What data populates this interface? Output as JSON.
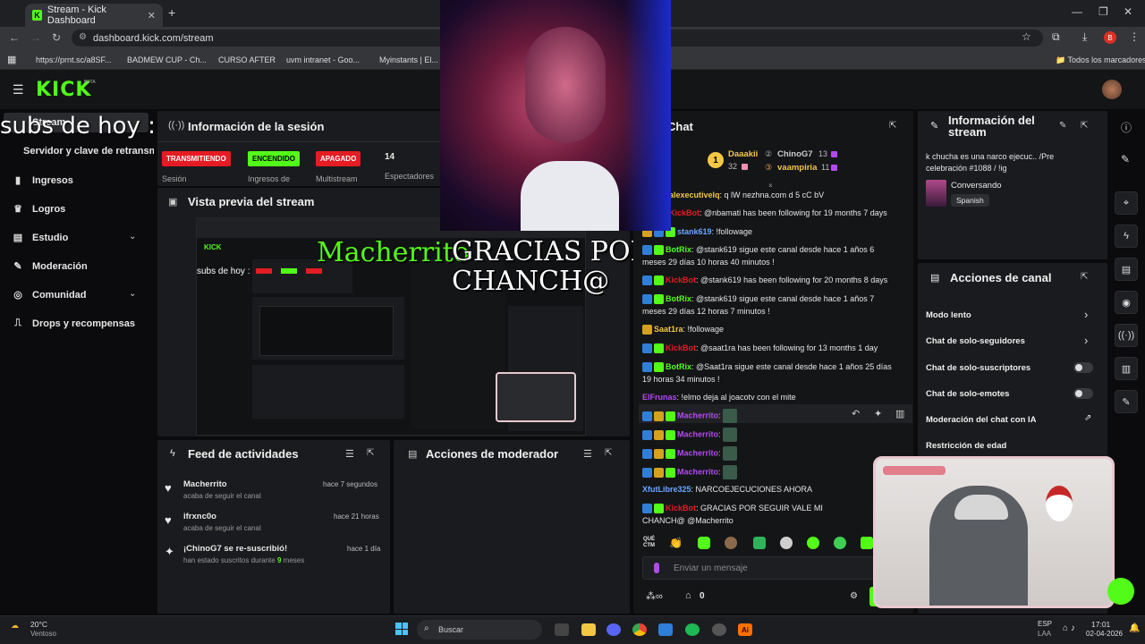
{
  "browser": {
    "tab_title": "Stream - Kick Dashboard",
    "url": "dashboard.kick.com/stream",
    "bookmarks": [
      "https://prnt.sc/a8SF...",
      "BADMEW CUP - Ch...",
      "CURSO AFTER",
      "uvm intranet - Goo...",
      "Myinstants | El..."
    ],
    "all_bookmarks": "Todos los marcadores",
    "profile_initial": "B"
  },
  "kick": {
    "logo": "KICK",
    "beta": "BETA"
  },
  "sidebar": {
    "items": [
      {
        "label": "Stream",
        "icon": "stream-icon"
      },
      {
        "label": "Servidor y clave de retransm",
        "icon": ""
      },
      {
        "label": "Ingresos",
        "icon": "bar-chart-icon"
      },
      {
        "label": "Logros",
        "icon": "trophy-icon"
      },
      {
        "label": "Estudio",
        "icon": "studio-icon"
      },
      {
        "label": "Moderación",
        "icon": "wrench-icon"
      },
      {
        "label": "Comunidad",
        "icon": "community-icon"
      },
      {
        "label": "Drops y recompensas",
        "icon": "drops-icon"
      }
    ]
  },
  "overlay": {
    "subs_text": "subs de hoy :",
    "thanks_user": "Macherrito",
    "thanks_text": "GRACIAS POR SEGUIR MI CHANCH@"
  },
  "session": {
    "title": "Información de la sesión",
    "live_badge": "TRANSMITIENDO",
    "live_label": "Sesión",
    "income_badge": "ENCENDIDO",
    "income_label": "Ingresos de",
    "multistream_badge": "APAGADO",
    "multistream_label": "Multistream",
    "viewers_value": "14",
    "viewers_label": "Espectadores"
  },
  "preview": {
    "title": "Vista previa del stream"
  },
  "activity": {
    "title": "Feed de actividades",
    "items": [
      {
        "name": "Macherrito",
        "desc": "acaba de seguir el canal",
        "time": "hace 7 segundos"
      },
      {
        "name": "ifrxnc0o",
        "desc": "acaba de seguir el canal",
        "time": "hace 21 horas"
      },
      {
        "name": "¡ChinoG7 se re-suscribió!",
        "desc_prefix": "han estado suscritos durante",
        "desc_num": "9",
        "desc_suffix": "meses",
        "time": "hace 1 día"
      }
    ]
  },
  "mod_actions": {
    "title": "Acciones de moderador"
  },
  "chat": {
    "title": "Chat",
    "leaders": [
      {
        "name": "Daaakii",
        "value": "32"
      },
      {
        "name": "ChinoG7",
        "value": "13"
      },
      {
        "name": "vaampiria",
        "value": "11"
      }
    ],
    "messages": [
      {
        "user": "alexecutivelq",
        "text": ": q lW nezhna.com d 5 cC bV"
      },
      {
        "user": "KickBot",
        "text": ": @nbamati has been following for 19 months 7 days"
      },
      {
        "user": "stank619",
        "text": ": !followage"
      },
      {
        "user": "BotRix",
        "text": ": @stank619 sigue este canal desde hace 1 años 6 meses 29 días 10 horas 40 minutos !"
      },
      {
        "user": "KickBot",
        "text": ": @stank619 has been following for 20 months 8 days"
      },
      {
        "user": "BotRix",
        "text": ": @stank619 sigue este canal desde hace 1 años 7 meses 29 días 12 horas 7 minutos !"
      },
      {
        "user": "Saat1ra",
        "text": ": !followage"
      },
      {
        "user": "KickBot",
        "text": ": @saat1ra has been following for 13 months 1 day"
      },
      {
        "user": "BotRix",
        "text": ": @Saat1ra sigue este canal desde hace 1 años 25 días 19 horas 34 minutos !"
      },
      {
        "user": "ElFrunas",
        "text": ": !elmo deja al joacotv con el mite"
      },
      {
        "user": "Macherrito",
        "text": ":"
      },
      {
        "user": "Macherrito",
        "text": ":"
      },
      {
        "user": "Macherrito",
        "text": ":"
      },
      {
        "user": "Macherrito",
        "text": ":"
      },
      {
        "user": "XfutLibre325",
        "text": ": NARCOEJECUCIONES AHORA"
      },
      {
        "user": "KickBot",
        "text": ": GRACIAS POR SEGUIR VALE MI CHANCH@ @Macherrito"
      }
    ],
    "input_placeholder": "Enviar un mensaje",
    "footer_count": "0",
    "emote_label": "QUÉ CTM"
  },
  "stream_info": {
    "title": "Información del stream",
    "stream_title": "k chucha es una narco ejecuc.. /Pre celebración #1088 / !ig",
    "category": "Conversando",
    "language": "Spanish"
  },
  "channel_actions": {
    "title": "Acciones de canal",
    "rows": [
      "Modo lento",
      "Chat de solo-seguidores",
      "Chat de solo-suscriptores",
      "Chat de solo-emotes",
      "Moderación del chat con IA",
      "Restricción de edad"
    ]
  },
  "taskbar": {
    "weather_temp": "20°C",
    "weather_desc": "Ventoso",
    "search": "Buscar",
    "lang": "ESP",
    "lang_sub": "LAA",
    "time": "17:01",
    "date": "02-04-2026"
  },
  "colors": {
    "kick_green": "#53fc18",
    "live_red": "#e51c23",
    "panel_bg": "#1a1b1e",
    "page_bg": "#0b0b0d"
  }
}
